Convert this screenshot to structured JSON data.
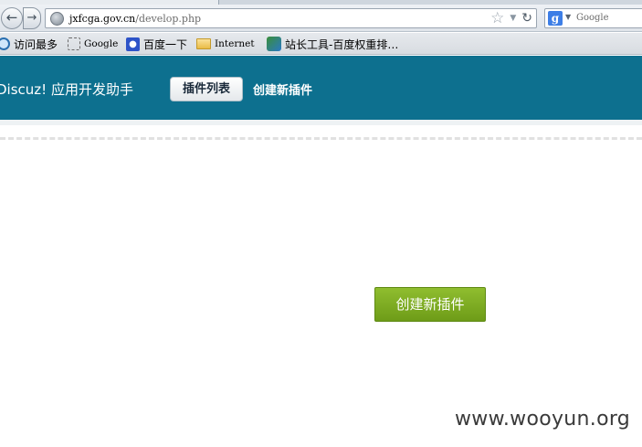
{
  "browser": {
    "url_host": "jxfcga.gov.cn",
    "url_path": "/develop.php",
    "search_placeholder": "Google",
    "google_icon_letter": "g",
    "icons": {
      "back": "back-arrow-icon",
      "forward": "forward-arrow-icon",
      "site": "globe-icon",
      "bookmark": "star-icon",
      "dropdown": "chevron-down-icon",
      "reload": "reload-icon",
      "search_engine": "google-icon"
    }
  },
  "bookmarks": [
    {
      "label": "访问最多",
      "icon": "magnifier-icon"
    },
    {
      "label": "Google",
      "icon": "blank-page-icon"
    },
    {
      "label": "百度一下",
      "icon": "baidu-paw-icon"
    },
    {
      "label": "Internet",
      "icon": "folder-icon"
    },
    {
      "label": "站长工具-百度权重排…",
      "icon": "site-icon"
    }
  ],
  "app": {
    "title": "Discuz! 应用开发助手",
    "tabs": [
      {
        "label": "插件列表",
        "active": true
      },
      {
        "label": "创建新插件",
        "active": false
      }
    ],
    "header_color": "#0d708f"
  },
  "main": {
    "create_button_label": "创建新插件",
    "create_button_color": "#7aa820"
  },
  "watermark": "www.wooyun.org"
}
